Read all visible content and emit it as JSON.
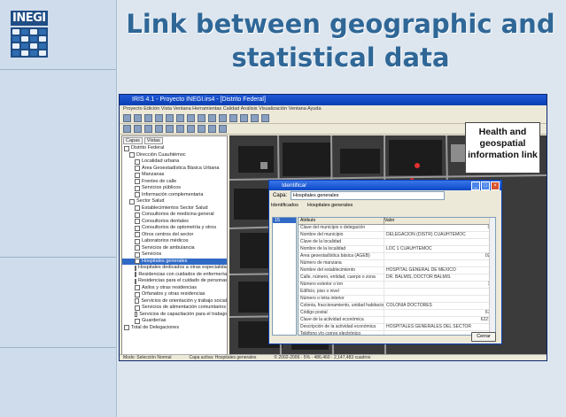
{
  "slide": {
    "title": "Link between geographic and statistical data",
    "logo_text": "INEGI",
    "callout": "Health and geospatial information link"
  },
  "app": {
    "title": "IRIS 4.1 - Proyecto INEGI.irs4 - [Distrito Federal]",
    "menu": "Proyecto  Edición  Vista  Ventana  Herramientas  Calidad  Análisis  Visualización  Ventana  Ayuda",
    "tree_tabs": [
      "Capas",
      "Vistas"
    ],
    "tree_nodes": [
      {
        "label": "Distrito Federal",
        "selected": false,
        "indent": 0
      },
      {
        "label": "Dirección Cuauhtémoc",
        "selected": false,
        "indent": 1
      },
      {
        "label": "Localidad urbana",
        "selected": false,
        "indent": 2
      },
      {
        "label": "Área Geoestadística Básica Urbana",
        "selected": false,
        "indent": 2
      },
      {
        "label": "Manzanas",
        "selected": false,
        "indent": 2
      },
      {
        "label": "Frentes de calle",
        "selected": false,
        "indent": 2
      },
      {
        "label": "Servicios públicos",
        "selected": false,
        "indent": 2
      },
      {
        "label": "Información complementaria",
        "selected": false,
        "indent": 2
      },
      {
        "label": "Sector Salud",
        "selected": false,
        "indent": 1
      },
      {
        "label": "Establecimientos Sector Salud",
        "selected": false,
        "indent": 2
      },
      {
        "label": "Consultorios de medicina general",
        "selected": false,
        "indent": 2
      },
      {
        "label": "Consultorios dentales",
        "selected": false,
        "indent": 2
      },
      {
        "label": "Consultorios de optometría y otros",
        "selected": false,
        "indent": 2
      },
      {
        "label": "Otros centros del sector",
        "selected": false,
        "indent": 2
      },
      {
        "label": "Laboratorios médicos",
        "selected": false,
        "indent": 2
      },
      {
        "label": "Servicios de ambulancia",
        "selected": false,
        "indent": 2
      },
      {
        "label": "Servicios",
        "selected": false,
        "indent": 2
      },
      {
        "label": "Hospitales generales",
        "selected": true,
        "indent": 2
      },
      {
        "label": "Hospitales dedicados a otras especialidades",
        "selected": false,
        "indent": 2
      },
      {
        "label": "Residencias con cuidados de enfermería",
        "selected": false,
        "indent": 2
      },
      {
        "label": "Residencias para el cuidado de personas",
        "selected": false,
        "indent": 2
      },
      {
        "label": "Asilos y otras residencias",
        "selected": false,
        "indent": 2
      },
      {
        "label": "Orfanatos y otras residencias",
        "selected": false,
        "indent": 2
      },
      {
        "label": "Servicios de orientación y trabajo social",
        "selected": false,
        "indent": 2
      },
      {
        "label": "Servicios de alimentación comunitarios",
        "selected": false,
        "indent": 2
      },
      {
        "label": "Servicios de capacitación para el trabajo",
        "selected": false,
        "indent": 2
      },
      {
        "label": "Guarderías",
        "selected": false,
        "indent": 2
      },
      {
        "label": "Total de Delegaciones",
        "selected": false,
        "indent": 0
      }
    ],
    "status_left": "Modo: Selección Normal",
    "status_mid": "Capa activa: Hospitales generales",
    "status_right": "© 2002-2006 · 5% · 486,460 · 2,147,483 cuadros"
  },
  "dialog": {
    "title": "Identificar",
    "layer_label": "Capa:",
    "layer_value": "Hospitales generales",
    "list_header": "Identificados",
    "list_item": "15",
    "tab_label": "Hospitales generales",
    "col_attr": "Atributo",
    "col_val": "Valor",
    "rows": [
      {
        "attr": "Clave del municipio o delegación",
        "val": "015"
      },
      {
        "attr": "Nombre del municipio",
        "val": "DELEGACIÓN (DISTR) CUAUHTÉMOC"
      },
      {
        "attr": "Clave de la localidad",
        "val": "1"
      },
      {
        "attr": "Nombre de la localidad",
        "val": "LOC 1 CUAUHTÉMOC"
      },
      {
        "attr": "Área geoestadística básica (AGEB)",
        "val": "0239"
      },
      {
        "attr": "Número de manzana",
        "val": ""
      },
      {
        "attr": "Nombre del establecimiento",
        "val": "HOSPITAL GENERAL DE MÉXICO"
      },
      {
        "attr": "Calle, número, entidad, cuerpo o zona",
        "val": "DR. BALMIS, DOCTOR BALMIS"
      },
      {
        "attr": "Número exterior o km",
        "val": "148"
      },
      {
        "attr": "Edificio, piso o nivel",
        "val": ""
      },
      {
        "attr": "Número o letra interior",
        "val": ""
      },
      {
        "attr": "Colonia, fraccionamiento, unidad habitacional",
        "val": "COLONIA DOCTORES"
      },
      {
        "attr": "Código postal",
        "val": "6720"
      },
      {
        "attr": "Clave de la actividad económica",
        "val": "622112"
      },
      {
        "attr": "Descripción de la actividad económica",
        "val": "HOSPITALES GENERALES DEL SECTOR"
      },
      {
        "attr": "Teléfono y/o correo electrónico",
        "val": ""
      },
      {
        "attr": "Número de local",
        "val": ""
      }
    ],
    "close_label": "Cerrar"
  },
  "colors": {
    "title_color": "#2f6797",
    "titlebar_blue": "#0a3fb3",
    "selection_blue": "#316ac5"
  }
}
